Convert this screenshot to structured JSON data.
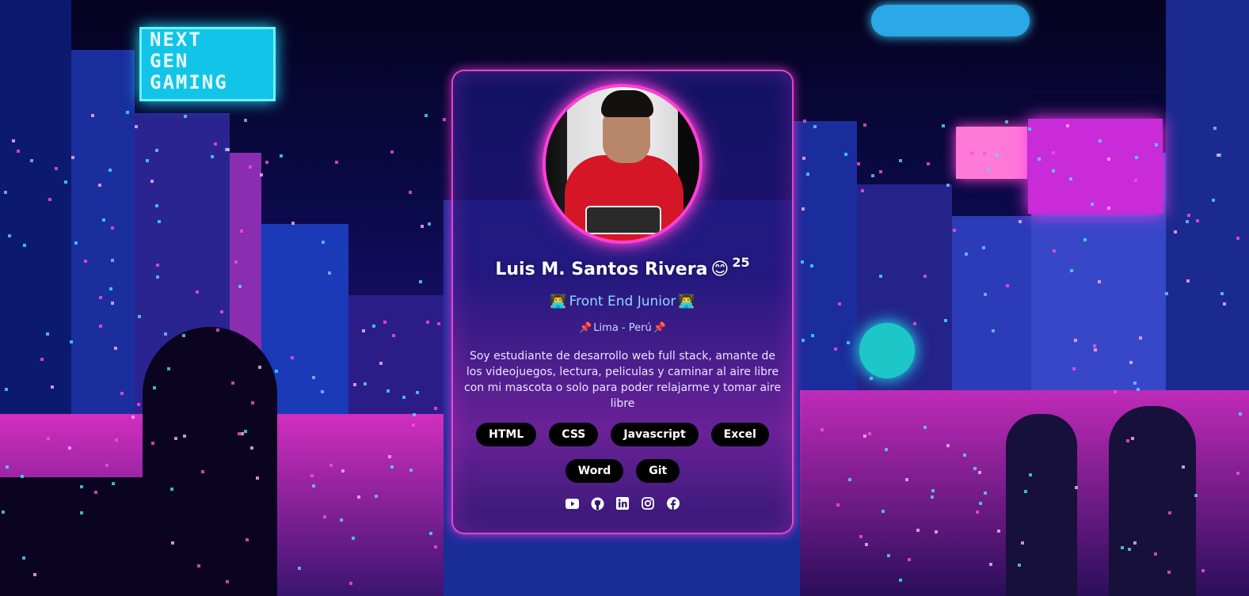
{
  "background": {
    "sign_next_lines": [
      "NEXT",
      "GEN",
      "GAMING"
    ],
    "accent_pink": "#ff3fd6",
    "accent_cyan": "#1fe0ff"
  },
  "profile": {
    "name": "Luis M. Santos Rivera",
    "name_emoji": "😊",
    "age": "25",
    "role": "Front End Junior",
    "role_emoji": "👨‍💻",
    "location": "Lima - Perú",
    "location_emoji": "📌",
    "bio": "Soy estudiante de desarrollo web full stack, amante de los videojuegos, lectura, peliculas y caminar al aire libre con mi mascota o solo para poder relajarme y tomar aire libre"
  },
  "skills": [
    "HTML",
    "CSS",
    "Javascript",
    "Excel",
    "Word",
    "Git"
  ],
  "socials": [
    {
      "name": "youtube-icon"
    },
    {
      "name": "github-icon"
    },
    {
      "name": "linkedin-icon"
    },
    {
      "name": "instagram-icon"
    },
    {
      "name": "facebook-icon"
    }
  ]
}
